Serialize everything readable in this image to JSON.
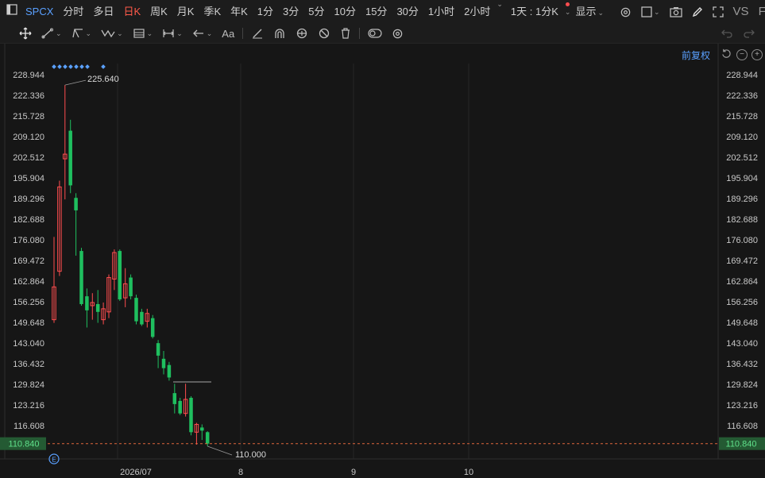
{
  "toolbar": {
    "symbol": "SPCX",
    "periods": [
      "分时",
      "多日",
      "日K",
      "周K",
      "月K",
      "季K",
      "年K",
      "1分",
      "3分",
      "5分",
      "10分",
      "15分",
      "30分",
      "1小时",
      "2小时",
      "1天 : 1分K"
    ],
    "active_period": "日K",
    "display_label": "显示",
    "vs_label": "VS",
    "fio_label": "FIO"
  },
  "chart_header": {
    "adjust_label": "前复权"
  },
  "colors": {
    "up": "#ff4d4f",
    "down": "#1fbf5f",
    "grid": "#262626",
    "axis_text": "#c8c8c8",
    "last_price_bg": "#245a33"
  },
  "chart_data": {
    "type": "candlestick",
    "ylim": [
      106.5,
      233
    ],
    "y_ticks": [
      228.944,
      222.336,
      215.728,
      209.12,
      202.512,
      195.904,
      189.296,
      182.688,
      176.08,
      169.472,
      162.864,
      156.256,
      149.648,
      143.04,
      136.432,
      129.824,
      123.216,
      116.608
    ],
    "x_tick_labels": [
      "2026/07",
      "8",
      "9",
      "10"
    ],
    "last_price": "110.840",
    "max_label": "225.640",
    "min_label": "110.000",
    "candles": [
      {
        "o": 150.5,
        "h": 177.0,
        "l": 149.5,
        "c": 161.0
      },
      {
        "o": 166.0,
        "h": 195.0,
        "l": 164.5,
        "c": 193.0
      },
      {
        "o": 202.0,
        "h": 225.6,
        "l": 189.0,
        "c": 203.5
      },
      {
        "o": 211.0,
        "h": 214.5,
        "l": 191.0,
        "c": 193.5
      },
      {
        "o": 189.5,
        "h": 191.0,
        "l": 171.0,
        "c": 185.5
      },
      {
        "o": 172.5,
        "h": 173.5,
        "l": 155.0,
        "c": 155.5
      },
      {
        "o": 158.0,
        "h": 160.5,
        "l": 148.0,
        "c": 153.5
      },
      {
        "o": 155.0,
        "h": 159.0,
        "l": 150.5,
        "c": 156.0
      },
      {
        "o": 155.5,
        "h": 160.0,
        "l": 149.5,
        "c": 153.0
      },
      {
        "o": 150.5,
        "h": 156.0,
        "l": 149.0,
        "c": 154.0
      },
      {
        "o": 153.0,
        "h": 165.0,
        "l": 151.0,
        "c": 164.0
      },
      {
        "o": 163.5,
        "h": 173.0,
        "l": 160.0,
        "c": 172.0
      },
      {
        "o": 172.5,
        "h": 173.0,
        "l": 156.5,
        "c": 157.0
      },
      {
        "o": 157.5,
        "h": 167.0,
        "l": 154.5,
        "c": 162.0
      },
      {
        "o": 164.0,
        "h": 165.0,
        "l": 157.0,
        "c": 158.0
      },
      {
        "o": 157.5,
        "h": 158.5,
        "l": 149.0,
        "c": 150.0
      },
      {
        "o": 153.0,
        "h": 154.0,
        "l": 148.5,
        "c": 149.0
      },
      {
        "o": 150.0,
        "h": 154.0,
        "l": 148.0,
        "c": 152.5
      },
      {
        "o": 151.0,
        "h": 152.0,
        "l": 144.5,
        "c": 145.0
      },
      {
        "o": 143.0,
        "h": 144.0,
        "l": 135.0,
        "c": 139.0
      },
      {
        "o": 138.0,
        "h": 140.5,
        "l": 133.0,
        "c": 135.0
      },
      {
        "o": 136.0,
        "h": 137.0,
        "l": 131.0,
        "c": 132.0
      },
      {
        "o": 127.0,
        "h": 130.0,
        "l": 120.5,
        "c": 123.5
      },
      {
        "o": 124.5,
        "h": 125.5,
        "l": 120.0,
        "c": 120.5
      },
      {
        "o": 120.5,
        "h": 130.0,
        "l": 119.5,
        "c": 125.0
      },
      {
        "o": 125.5,
        "h": 126.0,
        "l": 113.5,
        "c": 114.5
      },
      {
        "o": 114.5,
        "h": 117.5,
        "l": 110.5,
        "c": 117.0
      },
      {
        "o": 116.0,
        "h": 117.0,
        "l": 112.0,
        "c": 115.0
      },
      {
        "o": 114.5,
        "h": 114.8,
        "l": 110.0,
        "c": 110.84
      }
    ]
  }
}
